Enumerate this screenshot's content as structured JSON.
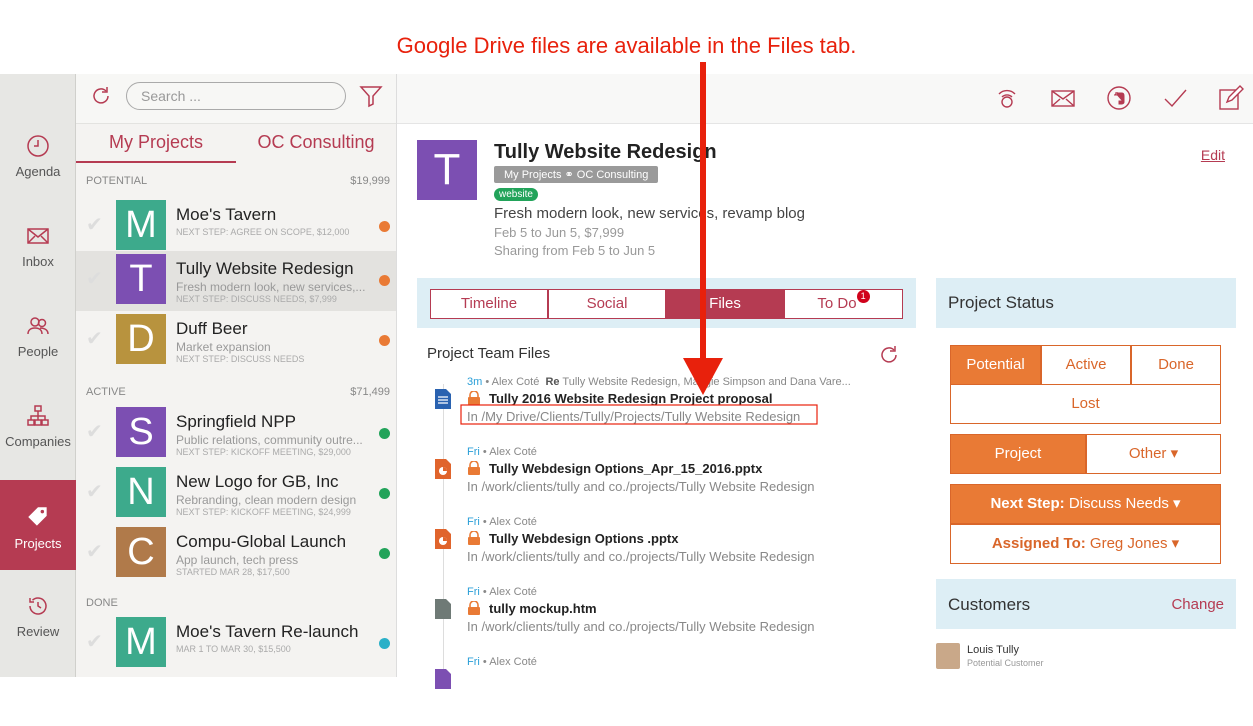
{
  "annotation": "Google Drive files are available in the Files tab.",
  "nav": [
    {
      "label": "Agenda",
      "icon": "clock-icon"
    },
    {
      "label": "Inbox",
      "icon": "envelope-icon"
    },
    {
      "label": "People",
      "icon": "people-icon"
    },
    {
      "label": "Companies",
      "icon": "org-chart-icon"
    },
    {
      "label": "Projects",
      "icon": "tag-icon"
    },
    {
      "label": "Review",
      "icon": "history-icon"
    }
  ],
  "search": {
    "placeholder": "Search ..."
  },
  "list_tabs": [
    "My Projects",
    "OC Consulting"
  ],
  "sections": [
    {
      "label": "POTENTIAL",
      "total": "$19,999"
    },
    {
      "label": "ACTIVE",
      "total": "$71,499"
    },
    {
      "label": "DONE"
    }
  ],
  "projects": [
    {
      "letter": "M",
      "color": "#3daa8c",
      "title": "Moe's Tavern",
      "subtitle": "",
      "step": "NEXT STEP: AGREE ON SCOPE, $12,000",
      "dot": "#e97a35"
    },
    {
      "letter": "T",
      "color": "#7c4fb2",
      "title": "Tully Website Redesign",
      "subtitle": "Fresh modern look, new services,...",
      "step": "NEXT STEP: DISCUSS NEEDS, $7,999",
      "dot": "#e97a35"
    },
    {
      "letter": "D",
      "color": "#b8933e",
      "title": "Duff Beer",
      "subtitle": "Market expansion",
      "step": "NEXT STEP: DISCUSS NEEDS",
      "dot": "#e97a35"
    },
    {
      "letter": "S",
      "color": "#7c4fb2",
      "title": "Springfield NPP",
      "subtitle": "Public relations, community outre...",
      "step": "NEXT STEP: KICKOFF MEETING, $29,000",
      "dot": "#22a35a"
    },
    {
      "letter": "N",
      "color": "#3daa8c",
      "title": "New Logo for GB, Inc",
      "subtitle": "Rebranding, clean modern design",
      "step": "NEXT STEP: KICKOFF MEETING, $24,999",
      "dot": "#22a35a"
    },
    {
      "letter": "C",
      "color": "#b07a4a",
      "title": "Compu-Global Launch",
      "subtitle": "App launch, tech press",
      "step": "STARTED MAR 28, $17,500",
      "dot": "#22a35a"
    },
    {
      "letter": "M",
      "color": "#3daa8c",
      "title": "Moe's Tavern Re-launch",
      "subtitle": "",
      "step": "MAR 1 TO MAR 30, $15,500",
      "dot": "#2ab0c8"
    }
  ],
  "detail": {
    "letter": "T",
    "title": "Tully Website Redesign",
    "pill": "My Projects ⚭ OC Consulting",
    "tag": "website",
    "description": "Fresh modern look, new services, revamp blog",
    "dates": "Feb 5 to Jun 5, $7,999",
    "sharing": "Sharing from Feb 5 to Jun 5",
    "edit": "Edit"
  },
  "tabs": [
    {
      "label": "Timeline"
    },
    {
      "label": "Social"
    },
    {
      "label": "Files"
    },
    {
      "label": "To Do",
      "badge": "1"
    }
  ],
  "files_title": "Project Team Files",
  "files": [
    {
      "ago": "3m",
      "who": "Alex Coté",
      "re": "Re",
      "subject": "Tully Website Redesign, Maggie Simpson and Dana Vare...",
      "name": "Tully 2016 Website Redesign Project proposal",
      "path": "In /My Drive/Clients/Tully/Projects/Tully Website Redesign",
      "type": "doc"
    },
    {
      "ago": "Fri",
      "who": "Alex Coté",
      "name": "Tully Webdesign Options_Apr_15_2016.pptx",
      "path": "In /work/clients/tully and co./projects/Tully Website Redesign",
      "type": "ppt"
    },
    {
      "ago": "Fri",
      "who": "Alex Coté",
      "name": "Tully Webdesign Options .pptx",
      "path": "In /work/clients/tully and co./projects/Tully Website Redesign",
      "type": "ppt"
    },
    {
      "ago": "Fri",
      "who": "Alex Coté",
      "name": "tully mockup.htm",
      "path": "In /work/clients/tully and co./projects/Tully Website Redesign",
      "type": "htm"
    },
    {
      "ago": "Fri",
      "who": "Alex Coté",
      "name": "",
      "path": "",
      "type": "other"
    }
  ],
  "status": {
    "title": "Project Status",
    "states": [
      "Potential",
      "Active",
      "Done",
      "Lost"
    ],
    "kind": [
      "Project",
      "Other ▾"
    ],
    "next_label": "Next Step:",
    "next_value": "Discuss Needs ▾",
    "assigned_label": "Assigned To:",
    "assigned_value": "Greg Jones ▾"
  },
  "customers": {
    "title": "Customers",
    "change": "Change",
    "name": "Louis Tully",
    "role": "Potential Customer"
  }
}
